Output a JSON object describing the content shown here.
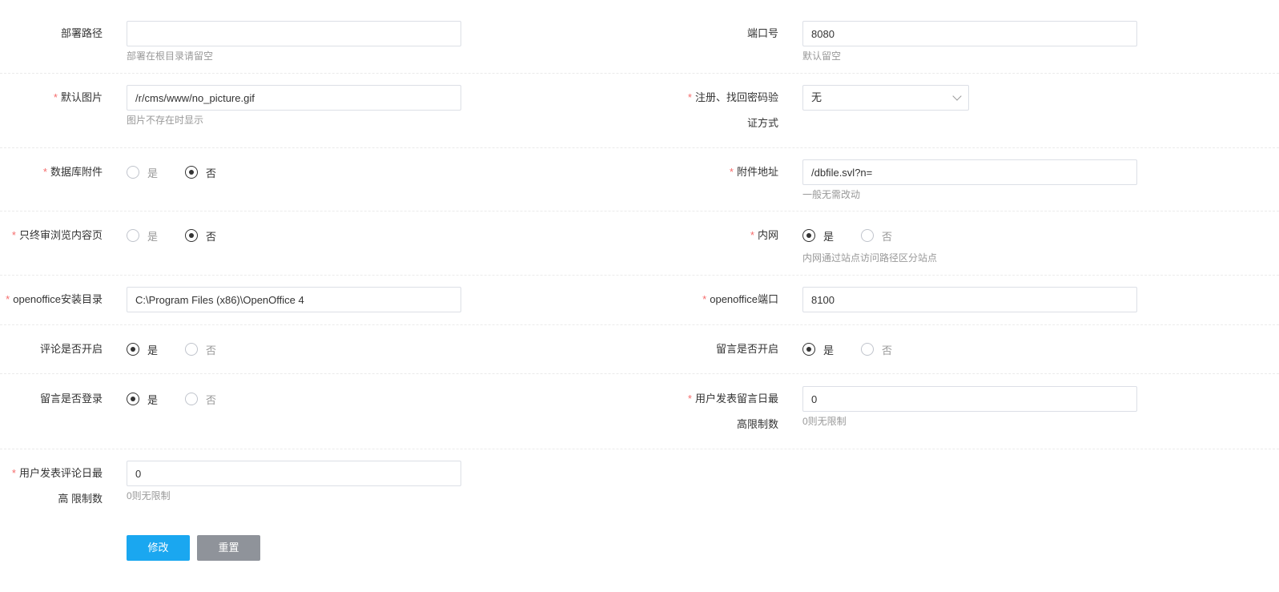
{
  "form": {
    "deploy_path": {
      "label": "部署路径",
      "value": "",
      "hint": "部署在根目录请留空"
    },
    "port": {
      "label": "端口号",
      "value": "8080",
      "hint": "默认留空"
    },
    "default_image": {
      "label": "默认图片",
      "value": "/r/cms/www/no_picture.gif",
      "hint": "图片不存在时显示"
    },
    "verify_mode": {
      "label_line1": "注册、找回密码验",
      "label_line2": "证方式",
      "value": "无"
    },
    "db_attachment": {
      "label": "数据库附件",
      "yes": "是",
      "no": "否",
      "selected": "no"
    },
    "attachment_url": {
      "label": "附件地址",
      "value": "/dbfile.svl?n=",
      "hint": "一般无需改动"
    },
    "final_review_only": {
      "label": "只终审浏览内容页",
      "yes": "是",
      "no": "否",
      "selected": "no"
    },
    "intranet": {
      "label": "内网",
      "yes": "是",
      "no": "否",
      "selected": "yes",
      "hint": "内网通过站点访问路径区分站点"
    },
    "openoffice_dir": {
      "label": "openoffice安装目录",
      "value": "C:\\Program Files (x86)\\OpenOffice 4"
    },
    "openoffice_port": {
      "label": "openoffice端口",
      "value": "8100"
    },
    "comment_enabled": {
      "label": "评论是否开启",
      "yes": "是",
      "no": "否",
      "selected": "yes"
    },
    "message_enabled": {
      "label": "留言是否开启",
      "yes": "是",
      "no": "否",
      "selected": "yes"
    },
    "message_login": {
      "label": "留言是否登录",
      "yes": "是",
      "no": "否",
      "selected": "yes"
    },
    "message_daily_limit": {
      "label_line1": "用户发表留言日最",
      "label_line2": "高限制数",
      "value": "0",
      "hint": "0则无限制"
    },
    "comment_daily_limit": {
      "label_line1": "用户发表评论日最",
      "label_line2": "高 限制数",
      "value": "0",
      "hint": "0则无限制"
    }
  },
  "buttons": {
    "submit": "修改",
    "reset": "重置"
  },
  "colors": {
    "required": "#f56c6c",
    "primary": "#1aa7f0",
    "secondary": "#8f939a"
  }
}
